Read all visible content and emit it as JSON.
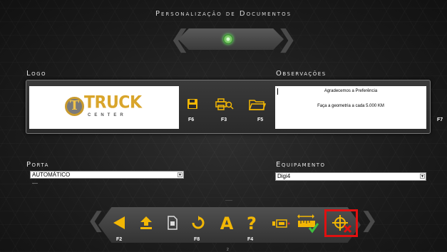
{
  "window": {
    "title": "Personalização de Documentos"
  },
  "sections": {
    "logo_label": "Logo",
    "observacoes_label": "Observações",
    "porta_label": "Porta",
    "equipamento_label": "Equipamento"
  },
  "logo": {
    "brand": "TRUCK",
    "brand_sub": "CENTER",
    "badge": "T"
  },
  "toolbar": {
    "save_key": "F6",
    "print_key": "F3",
    "open_key": "F5",
    "right_key": "F7"
  },
  "observacoes": {
    "line1": "Agradecemos a Preferência",
    "line2": "Faça a geometria a cada 5.000 KM"
  },
  "porta": {
    "selected": "AUTOMÁTICO",
    "sub_text": "----"
  },
  "equipamento": {
    "selected": "Digi4"
  },
  "bottom_bar": {
    "back_key": "F2",
    "refresh_key": "F8",
    "help_key": "F4",
    "font_glyph": "A",
    "help_glyph": "?",
    "center_dashes": "-----"
  },
  "page": {
    "number": "2"
  },
  "colors": {
    "accent": "#f2b705",
    "status_ok": "#6fcf5a",
    "highlight": "#e01010",
    "check": "#3fbf3f",
    "close_x": "#e01010"
  },
  "icons": {
    "status": "status-dot-icon",
    "save": "save-icon",
    "print_preview": "print-preview-icon",
    "open": "folder-open-icon",
    "back": "back-arrow-icon",
    "upload": "upload-icon",
    "document": "document-icon",
    "refresh": "refresh-icon",
    "font": "font-icon",
    "help": "help-icon",
    "card_reader": "card-reader-icon",
    "ruler_check": "ruler-check-icon",
    "crosshair_cancel": "crosshair-cancel-icon"
  }
}
